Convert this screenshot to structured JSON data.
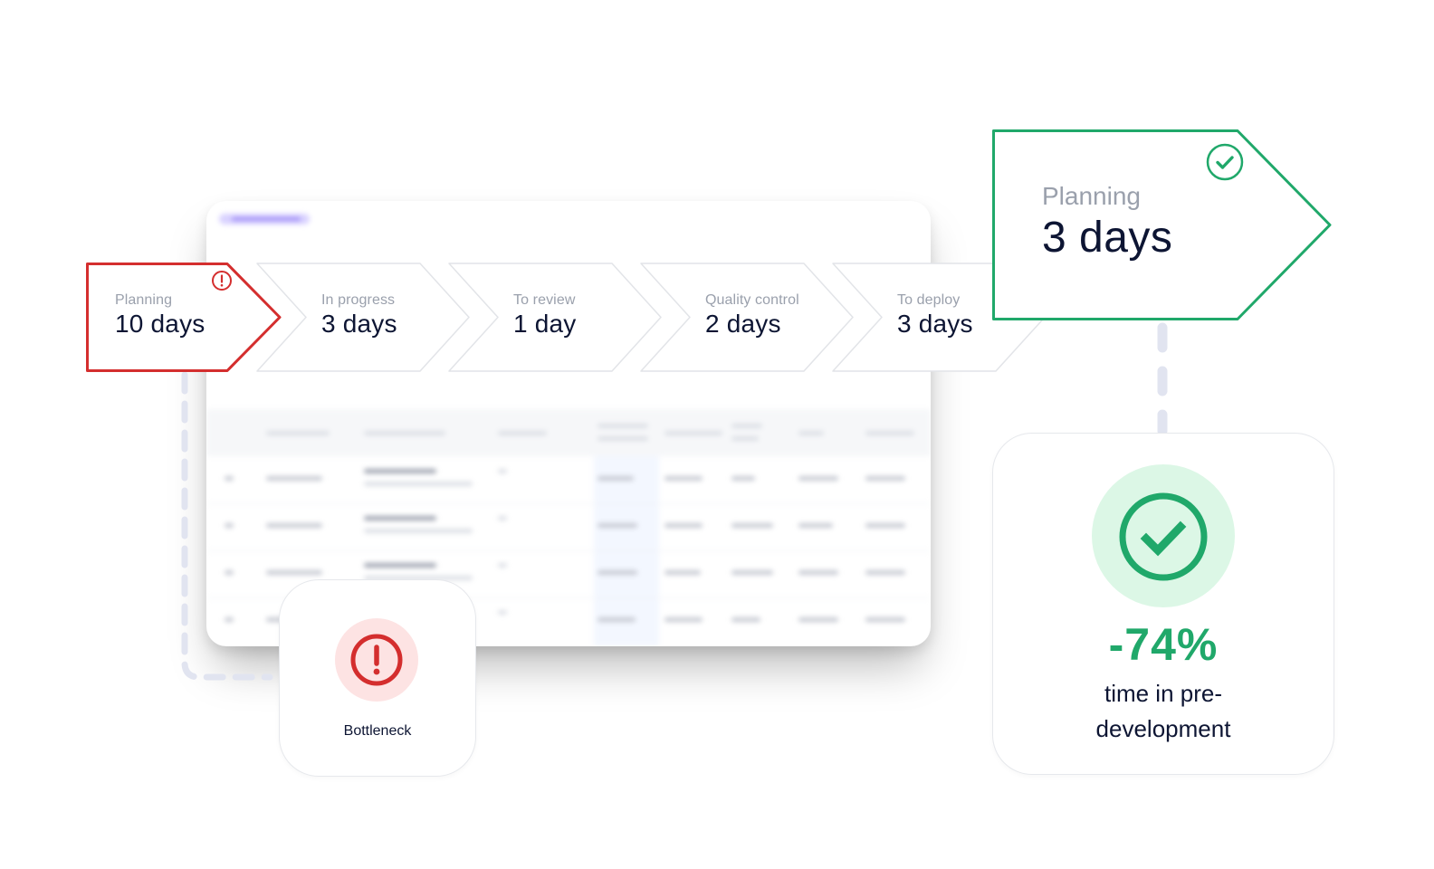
{
  "pipeline": {
    "stages": [
      {
        "label": "Planning",
        "value": "10 days",
        "status": "bottleneck"
      },
      {
        "label": "In progress",
        "value": "3 days",
        "status": "normal"
      },
      {
        "label": "To review",
        "value": "1 day",
        "status": "normal"
      },
      {
        "label": "Quality control",
        "value": "2 days",
        "status": "normal"
      },
      {
        "label": "To deploy",
        "value": "3 days",
        "status": "normal"
      }
    ]
  },
  "improved_stage": {
    "label": "Planning",
    "value": "3 days",
    "status": "success"
  },
  "bottleneck_card": {
    "title": "Bottleneck",
    "icon": "alert-circle-icon"
  },
  "result_card": {
    "metric": "-74%",
    "description": "time in pre-development",
    "icon": "check-circle-icon"
  },
  "colors": {
    "bottleneck": "#d42e2e",
    "success": "#20a86a",
    "connector": "#e1e4f0",
    "text_primary": "#0d1533",
    "text_muted": "#9aa0ac"
  }
}
